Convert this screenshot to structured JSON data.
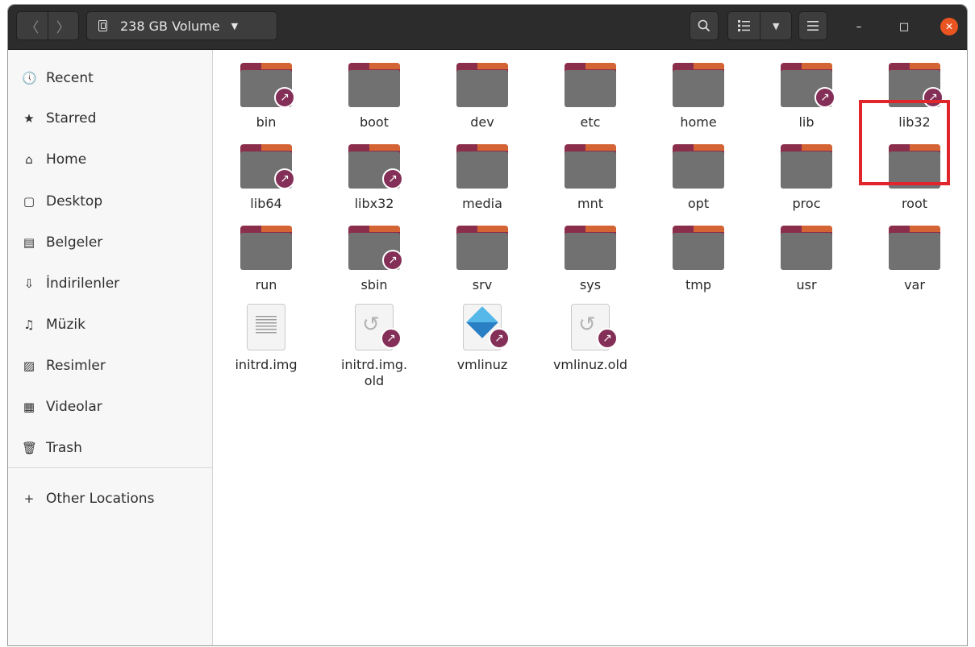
{
  "header": {
    "back_icon": "chevron-left-icon",
    "forward_icon": "chevron-right-icon",
    "path_label": "238 GB Volume",
    "caret_glyph": "▼",
    "search_icon": "search-icon",
    "list_view_icon": "list-view-icon",
    "menu_icon": "hamburger-menu-icon",
    "minimize_glyph": "–",
    "maximize_glyph": "□",
    "close_glyph": "✕"
  },
  "sidebar": {
    "items": [
      {
        "label": "Recent",
        "icon": "clock-icon",
        "glyph": "🕔"
      },
      {
        "label": "Starred",
        "icon": "star-icon",
        "glyph": "★"
      },
      {
        "label": "Home",
        "icon": "home-icon",
        "glyph": "⌂"
      },
      {
        "label": "Desktop",
        "icon": "desktop-icon",
        "glyph": "▢"
      },
      {
        "label": "Belgeler",
        "icon": "document-icon",
        "glyph": "▤"
      },
      {
        "label": "İndirilenler",
        "icon": "download-icon",
        "glyph": "⇩"
      },
      {
        "label": "Müzik",
        "icon": "music-icon",
        "glyph": "♫"
      },
      {
        "label": "Resimler",
        "icon": "picture-icon",
        "glyph": "▨"
      },
      {
        "label": "Videolar",
        "icon": "film-icon",
        "glyph": "▦"
      },
      {
        "label": "Trash",
        "icon": "trash-icon",
        "glyph": "🗑"
      },
      {
        "label": "Other Locations",
        "icon": "plus-icon",
        "glyph": "+"
      }
    ]
  },
  "files": [
    {
      "name": "bin",
      "type": "folder",
      "link": true
    },
    {
      "name": "boot",
      "type": "folder",
      "link": false
    },
    {
      "name": "dev",
      "type": "folder",
      "link": false
    },
    {
      "name": "etc",
      "type": "folder",
      "link": false
    },
    {
      "name": "home",
      "type": "folder",
      "link": false,
      "highlighted": true
    },
    {
      "name": "lib",
      "type": "folder",
      "link": true
    },
    {
      "name": "lib32",
      "type": "folder",
      "link": true
    },
    {
      "name": "lib64",
      "type": "folder",
      "link": true
    },
    {
      "name": "libx32",
      "type": "folder",
      "link": true
    },
    {
      "name": "media",
      "type": "folder",
      "link": false
    },
    {
      "name": "mnt",
      "type": "folder",
      "link": false
    },
    {
      "name": "opt",
      "type": "folder",
      "link": false
    },
    {
      "name": "proc",
      "type": "folder",
      "link": false
    },
    {
      "name": "root",
      "type": "folder",
      "link": false
    },
    {
      "name": "run",
      "type": "folder",
      "link": false
    },
    {
      "name": "sbin",
      "type": "folder",
      "link": true
    },
    {
      "name": "srv",
      "type": "folder",
      "link": false
    },
    {
      "name": "sys",
      "type": "folder",
      "link": false
    },
    {
      "name": "tmp",
      "type": "folder",
      "link": false
    },
    {
      "name": "usr",
      "type": "folder",
      "link": false
    },
    {
      "name": "var",
      "type": "folder",
      "link": false
    },
    {
      "name": "initrd.img",
      "type": "text-file",
      "link": false
    },
    {
      "name": "initrd.img.\nold",
      "type": "restore-file",
      "link": true
    },
    {
      "name": "vmlinuz",
      "type": "kernel-file",
      "link": true
    },
    {
      "name": "vmlinuz.old",
      "type": "restore-file",
      "link": true
    }
  ],
  "colors": {
    "headerbar": "#2c2c2c",
    "folder_body": "#717171",
    "folder_tab": "#8a2e4c",
    "link_badge": "#842f57",
    "close_button": "#e95420",
    "highlight_box": "#e0262a"
  }
}
